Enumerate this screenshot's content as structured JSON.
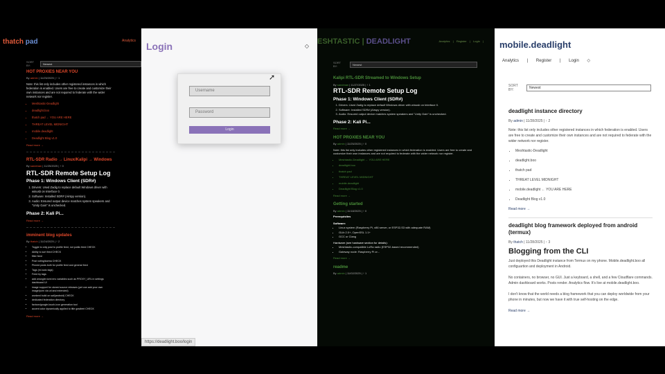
{
  "panel1": {
    "logo_a": "thatch",
    "logo_b": " pad",
    "nav": "Analytics",
    "sort_label": "SORT BY:",
    "sort_value": "Newest",
    "post1": {
      "title": "HOT PROXIES NEAR YOU",
      "meta_author": "admin",
      "meta_rest": " | 11/25/2025 | ↑ 1",
      "text": "Note: this list only includes other registered instances in which federation is enabled. Users are free to create and customize their own instances and are not required to federate with the wider network nor register.",
      "items": [
        "Meshtastic-Deadlight",
        "deadlight.boo",
        "thatch pad ← YOU ARE HERE",
        "THREAT LEVEL MIDNIGHT",
        "mobile.deadlight",
        "Deadlight Blog v1.0"
      ],
      "more": "Read more →"
    },
    "post2": {
      "title": "RTL-SDR Radio → Linux/Kalipi → Windows",
      "meta_author": "sandman",
      "meta_rest": " | 11/25/2025 | ↑ 0",
      "big": "RTL-SDR Remote Setup Log",
      "h1": "Phase 1: Windows Client (SDR#)",
      "steps": [
        "Drivers: Used Zadig to replace default Windows driver with winusb on Interface 0.",
        "Software: Installed SDR# (Airspy version).",
        "Audio: Ensured output device matches system speakers and \"Unity Gain\" is unchecked."
      ],
      "h2": "Phase 2: Kali Pi...",
      "more": "Read more →"
    },
    "post3": {
      "title": "imminent blog updates",
      "meta_author": "thatch",
      "meta_rest": " | 11/24/2025 | ↑ 2",
      "items": [
        "Toggle to only post to profile feed, not public feed CHECK",
        "Ability to sort feed CHECK",
        "filter feed",
        "Post voting/karma CHECK",
        "Pinned posts both for profile feed and general feed",
        "Tags (ml auto tags)",
        "Feed by tags",
        "add wrangler.toml env variables such as PROXY_URL in settings dashboard UI",
        "image support for cloned source releases (yet can add your own image/porn via url and extended)",
        "workerd build on sail(android) CHECK",
        "dedicated federation directory",
        "favicon/google-touch-icon generation tool",
        "accent color dynamically applied to title gradient CHECK"
      ],
      "more": "Read more →"
    }
  },
  "panel2": {
    "title": "Login",
    "username_placeholder": "Username",
    "password_placeholder": "Password",
    "login_button": "Login",
    "status_url": "https://deadlight.boo/login"
  },
  "panel3": {
    "logo_a": "ESHTASTIC",
    "logo_sep": " | ",
    "logo_b": "DEADLIGHT",
    "nav": [
      "Analytics",
      "|",
      "Register",
      "|",
      "Login",
      "|"
    ],
    "sort_label": "SORT BY:",
    "sort_value": "Newest",
    "post1": {
      "title": "Kalipi RTL-SDR Streamed to Windows Setup",
      "meta_author": "sandman",
      "meta_rest": " | 11/27/2025 | ↑ 1",
      "big": "RTL-SDR Remote Setup Log",
      "h1": "Phase 1: Windows Client (SDR#)",
      "steps": [
        "Drivers: Used Zadig to replace default Windows driver with winusb on Interface 0.",
        "Software: Installed SDR# (Airspy version).",
        "Audio: Ensured output device matches system speakers and \"Unity Gain\" is unchecked."
      ],
      "h2": "Phase 2: Kali Pi...",
      "more": "Read more →"
    },
    "post2": {
      "title": "HOT PROXIES NEAR YOU",
      "meta_author": "admin",
      "meta_rest": " | 11/25/2025 | ↑ 0",
      "text": "Note: this list only includes other registered instances in which federation is enabled. Users are free to create and customize their own instances and are not required to federate with the wider network nor register.",
      "items": [
        "Meshtastic-Deadlight ← YOU ARE HERE",
        "deadlight.boo",
        "thatch pad",
        "THREAT LEVEL MIDNIGHT",
        "mobile.deadlight",
        "Deadlight Blog v1.0"
      ],
      "more": "Read more →"
    },
    "post3": {
      "title": "Getting started",
      "meta_author": "admin",
      "meta_rest": " | 11/18/2025 | ↑ 0",
      "h": "Prerequisites",
      "sw": "Software:",
      "sw_items": [
        "Linux system (Raspberry Pi, x86 server, or ESP32-S3 with adequate RAM)",
        "GLib 2.0+, OpenSSL 1.1+",
        "GCC or Clang"
      ],
      "hw": "Hardware (see hardware section for details):",
      "hw_items": [
        "Meshtastic-compatible LoRa radio (ESP32-based recommended)",
        "Gateway node: Raspberry Pi or..."
      ],
      "more": "Read more →"
    },
    "post4": {
      "title": "readme",
      "meta_author": "admin",
      "meta_rest": " | 11/02/2025 | ↑ 1"
    }
  },
  "panel4": {
    "title": "mobile.deadlight",
    "nav": [
      "Analytics",
      "|",
      "Register",
      "|",
      "Login"
    ],
    "sort_label": "SORT BY:",
    "sort_value": "Newest",
    "post1": {
      "title": "deadlight instance directory",
      "meta_author": "admin",
      "meta_rest": " | 11/28/2025 | ↑ 2",
      "text": "Note: this list only includes other registered instances in which federation is enabled. Users are free to create and customize their own instances and are not required to federate with the wider network nor register.",
      "items": [
        "Meshtastic-Deadlight",
        "deadlight.boo",
        "thatch pad",
        "THREAT LEVEL MIDNIGHT",
        "mobile.deadlight ← YOU ARE HERE",
        "Deadlight Blog v1.0"
      ],
      "more": "Read more →"
    },
    "post2": {
      "title": "deadlight blog framework deployed from android (termux)",
      "meta_author": "thatch",
      "meta_rest": " | 11/28/2025 | ↑ 3",
      "big": "Blogging from the CLI",
      "p1": "Just deployed this Deadlight instance from Termux on my phone. Mobile.deadlight.boo all configuartion and deployment in Android.",
      "p2": "No containers, no browser, no GUI. Just a keyboard, a shell, and a few Cloudflare commands. Admin dashboard works. Posts render. Analytics flow. It's live at mobile.deadlight.boo.",
      "p3": "I don't know that the world needs a blog framework that you can deploy worldwide from your phone in minutes, but now we have it with true self-hosting on the edge.",
      "more": "Read more →"
    }
  }
}
